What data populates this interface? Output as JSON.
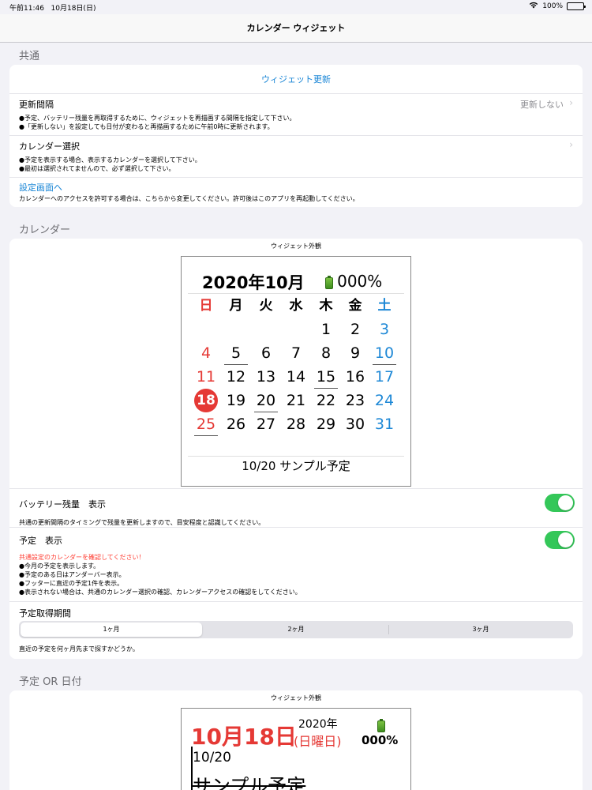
{
  "status_bar": {
    "time": "午前11:46",
    "date": "10月18日(日)",
    "battery": "100%"
  },
  "nav": {
    "title": "カレンダー ウィジェット"
  },
  "common": {
    "header": "共通",
    "widget_update": "ウィジェット更新",
    "interval_label": "更新間隔",
    "interval_value": "更新しない",
    "interval_notes": [
      "●予定、バッテリー残量を再取得するために、ウィジェットを再描画する間隔を指定して下さい。",
      "●「更新しない」を設定しても日付が変わると再描画するために午前0時に更新されます。"
    ],
    "calendar_select_label": "カレンダー選択",
    "calendar_select_notes": [
      "●予定を表示する場合、表示するカレンダーを選択して下さい。",
      "●最初は選択されてませんので、必ず選択して下さい。"
    ],
    "settings_link": "設定画面へ",
    "settings_note": "カレンダーへのアクセスを許可する場合は、こちらから変更してください。許可後はこのアプリを再起動してください。"
  },
  "calendar": {
    "header": "カレンダー",
    "caption": "ウィジェット外観",
    "widget_title": "2020年10月",
    "battery_pct": "000%",
    "weekdays": [
      "日",
      "月",
      "火",
      "水",
      "木",
      "金",
      "土"
    ],
    "weeks": [
      [
        "",
        "",
        "",
        "",
        "1",
        "2",
        "3"
      ],
      [
        "4",
        "5",
        "6",
        "7",
        "8",
        "9",
        "10"
      ],
      [
        "11",
        "12",
        "13",
        "14",
        "15",
        "16",
        "17"
      ],
      [
        "18",
        "19",
        "20",
        "21",
        "22",
        "23",
        "24"
      ],
      [
        "25",
        "26",
        "27",
        "28",
        "29",
        "30",
        "31"
      ]
    ],
    "today": "18",
    "event_days": [
      "5",
      "10",
      "15",
      "20",
      "25"
    ],
    "footer_event": "10/20 サンプル予定",
    "battery_label": "バッテリー残量　表示",
    "battery_toggle": "on",
    "battery_note": "共通の更新間隔のタイミングで残量を更新しますので、目安程度と認識してください。",
    "schedule_label": "予定　表示",
    "schedule_toggle": "on",
    "schedule_warning": "共通設定のカレンダーを確認してください！",
    "schedule_notes": [
      "●今月の予定を表示します。",
      "●予定のある日はアンダーバー表示。",
      "●フッターに直近の予定1件を表示。",
      "●表示されない場合は、共通のカレンダー選択の確認、カレンダーアクセスの確認をしてください。"
    ],
    "period_label": "予定取得期間",
    "period_options": [
      "1ヶ月",
      "2ヶ月",
      "3ヶ月"
    ],
    "period_selected": "1ヶ月",
    "period_note": "直近の予定を何ヶ月先まで探すかどうか。"
  },
  "schedule_or_date": {
    "header": "予定 OR 日付",
    "caption": "ウィジェット外観",
    "date_big": "10月18日",
    "year": "2020年",
    "weekday": "(日曜日)",
    "battery_pct": "000%",
    "event_date": "10/20",
    "event_title": "サンプル予定"
  },
  "colors": {
    "accent": "#1a86d6",
    "toggle_on": "#34c759",
    "sunday": "#e53935",
    "saturday": "#1e88d6"
  }
}
